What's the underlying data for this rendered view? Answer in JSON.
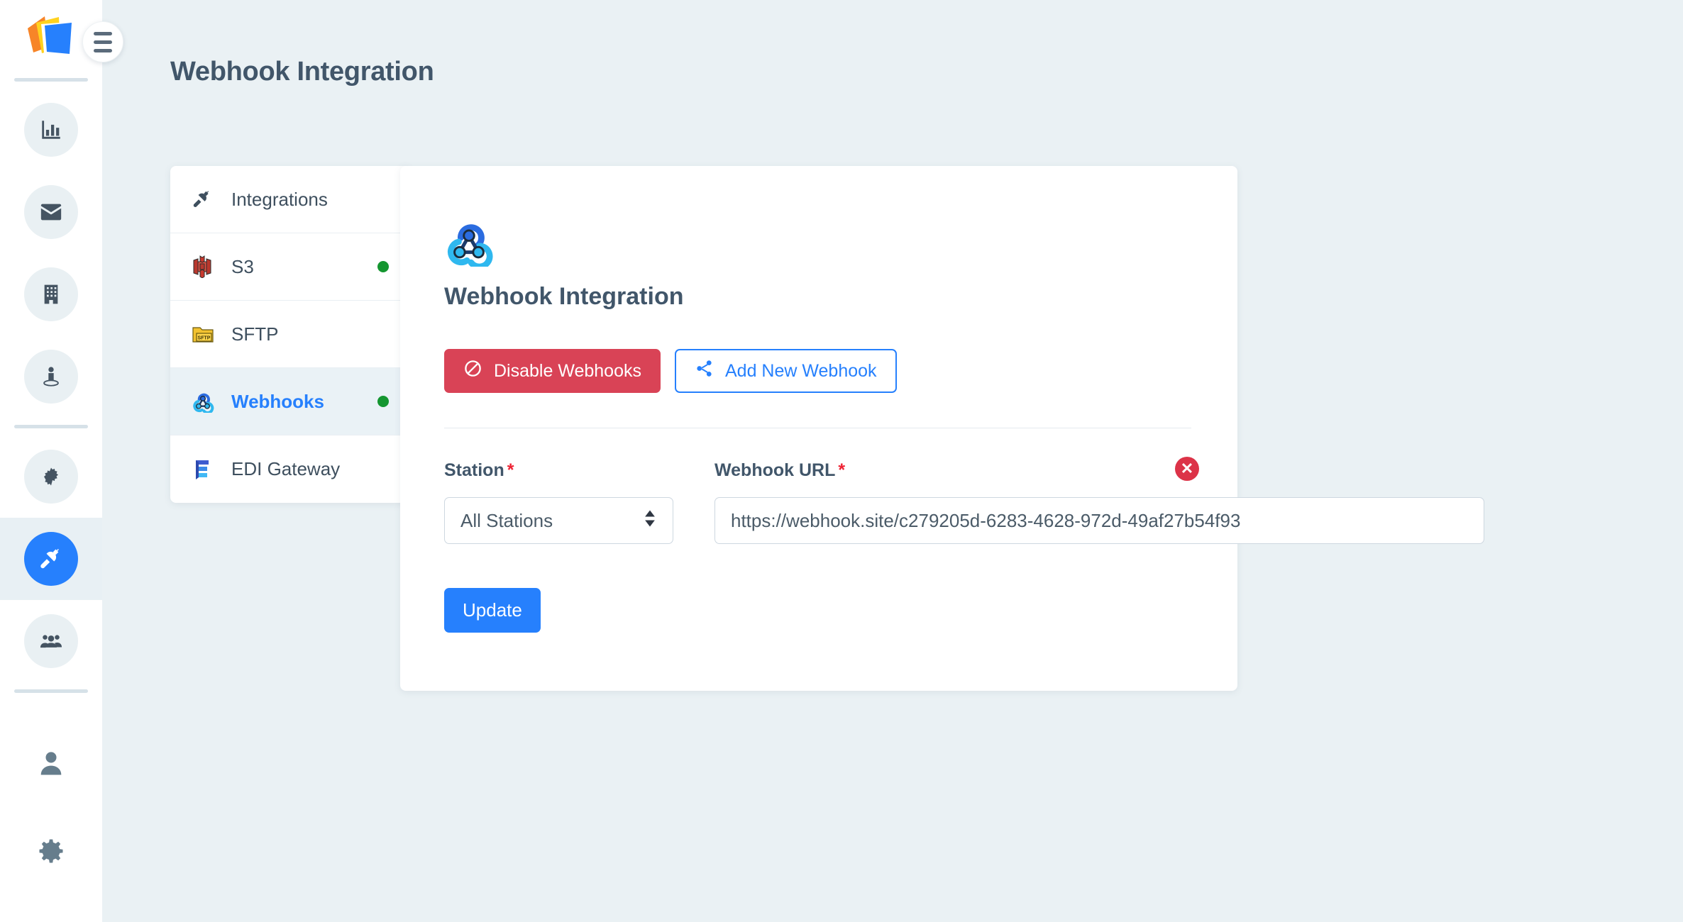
{
  "app": {
    "logo_name": "document-stack-logo",
    "accent_blue": "#2680fd",
    "danger_red": "#d94356",
    "status_green": "#149630",
    "page_background": "#eaf1f4",
    "heading_color": "#41566a"
  },
  "rail": {
    "menu_toggle_label": "menu-toggle",
    "items": [
      {
        "name": "analytics",
        "icon": "bar-chart-icon",
        "active": false
      },
      {
        "name": "messages",
        "icon": "envelope-icon",
        "active": false
      },
      {
        "name": "buildings",
        "icon": "building-icon",
        "active": false
      },
      {
        "name": "locations",
        "icon": "person-location-icon",
        "active": false
      },
      {
        "name": "operations",
        "icon": "gear-cog-icon",
        "active": false
      },
      {
        "name": "integrations",
        "icon": "plug-icon",
        "active": true
      },
      {
        "name": "teams",
        "icon": "users-group-icon",
        "active": false
      }
    ],
    "footer_items": [
      {
        "name": "profile",
        "icon": "user-icon"
      },
      {
        "name": "settings",
        "icon": "gear-icon"
      }
    ]
  },
  "header": {
    "title": "Webhook Integration"
  },
  "integration_list": {
    "items": [
      {
        "label": "Integrations",
        "icon": "plug-icon",
        "status": null,
        "selected": false
      },
      {
        "label": "S3",
        "icon": "s3-bucket-icon",
        "status": "online",
        "selected": false
      },
      {
        "label": "SFTP",
        "icon": "sftp-folder-icon",
        "status": null,
        "selected": false
      },
      {
        "label": "Webhooks",
        "icon": "webhook-icon",
        "status": "online",
        "selected": true
      },
      {
        "label": "EDI Gateway",
        "icon": "edi-e-icon",
        "status": null,
        "selected": false
      }
    ]
  },
  "main": {
    "brand_icon": "webhook-icon",
    "heading": "Webhook Integration",
    "disable_button": {
      "label": "Disable Webhooks",
      "icon": "ban-icon"
    },
    "add_button": {
      "label": "Add New Webhook",
      "icon": "share-nodes-icon"
    },
    "form": {
      "station": {
        "label": "Station",
        "required_mark": "*",
        "value": "All Stations",
        "options": [
          "All Stations"
        ]
      },
      "webhook_url": {
        "label": "Webhook URL",
        "required_mark": "*",
        "value": "https://webhook.site/c279205d-6283-4628-972d-49af27b54f93",
        "placeholder": "https://"
      },
      "remove_row_icon": "circle-x-icon",
      "remove_row_glyph": "✕"
    },
    "update_button": {
      "label": "Update"
    }
  }
}
